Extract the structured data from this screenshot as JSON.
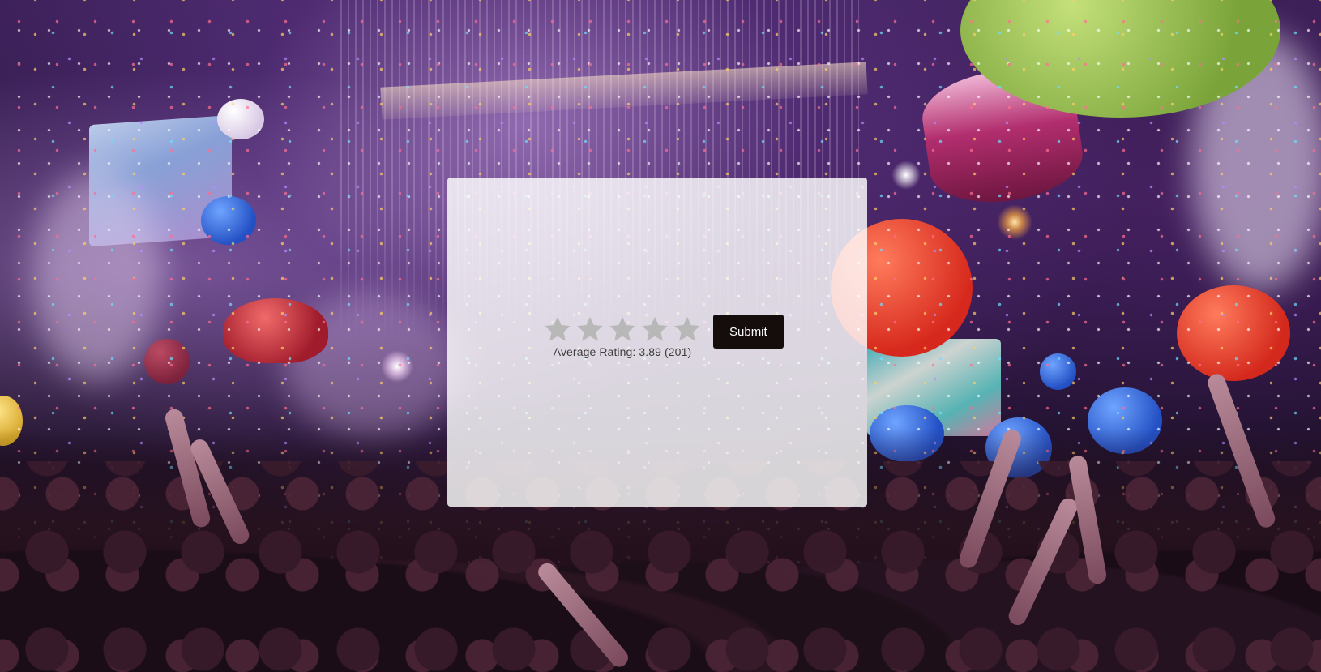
{
  "rating_widget": {
    "stars": [
      {
        "icon": "star-icon",
        "filled": false
      },
      {
        "icon": "star-icon",
        "filled": false
      },
      {
        "icon": "star-icon",
        "filled": false
      },
      {
        "icon": "star-icon",
        "filled": false
      },
      {
        "icon": "star-icon",
        "filled": false
      }
    ],
    "average_label": "Average Rating: 3.89 (201)",
    "submit_label": "Submit",
    "star_color": "#b8b8b8",
    "button_color": "#140d0b"
  }
}
